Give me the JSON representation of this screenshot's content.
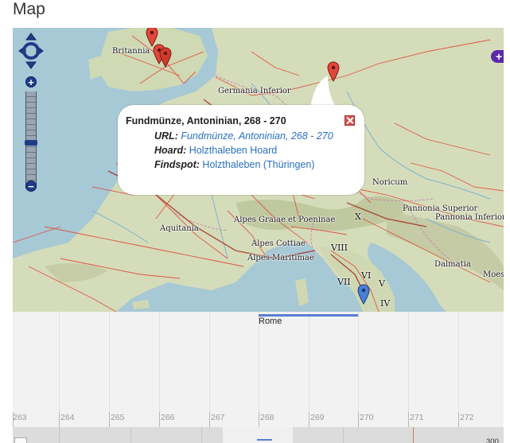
{
  "page": {
    "heading": "Map"
  },
  "map": {
    "regions": [
      {
        "name": "Britannia"
      },
      {
        "name": "Germania Inferior"
      },
      {
        "name": "Noricum"
      },
      {
        "name": "Pannonia Superior"
      },
      {
        "name": "Pannonia Inferior"
      },
      {
        "name": "Alpes Graiae et Poeninae"
      },
      {
        "name": "Aquitania"
      },
      {
        "name": "Alpes Cottiae"
      },
      {
        "name": "Alpes Maritimae"
      },
      {
        "name": "Dalmatia"
      },
      {
        "name": "Moesi"
      }
    ],
    "numerals": [
      "X",
      "VIII",
      "VII",
      "VI",
      "V",
      "IV"
    ],
    "markers": [
      {
        "color": "#e2463a"
      },
      {
        "color": "#e2463a"
      },
      {
        "color": "#e2463a"
      },
      {
        "color": "#4a7fd6"
      }
    ],
    "layer_switcher_icon": "plus-icon",
    "zoom_in": "+",
    "zoom_out": "−"
  },
  "popup": {
    "title": "Fundmünze, Antoninian, 268 - 270",
    "rows": [
      {
        "key": "URL:",
        "value": "Fundmünze, Antoninian, 268 - 270"
      },
      {
        "key": "Hoard:",
        "value": "Holzthaleben Hoard"
      },
      {
        "key": "Findspot:",
        "value": "Holzthaleben (Thüringen)"
      }
    ],
    "close_icon": "close-icon"
  },
  "timeline": {
    "event_label": "Rome",
    "ticks": [
      "263",
      "264",
      "265",
      "266",
      "267",
      "268",
      "269",
      "270",
      "271",
      "272"
    ],
    "overview_label": "300"
  },
  "colors": {
    "link": "#2a6fbf",
    "marker_red": "#e2463a",
    "marker_blue": "#4a7fd6",
    "event_bar": "#5a7fd1",
    "zoom_control": "#1e3c88"
  }
}
